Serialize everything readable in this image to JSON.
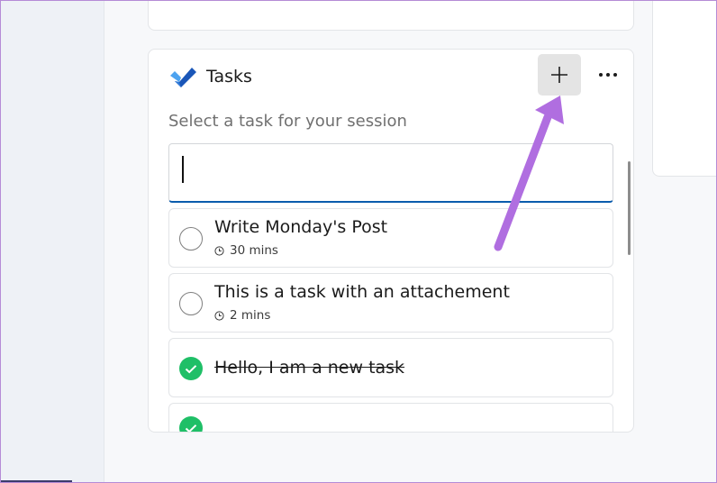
{
  "header": {
    "title": "Tasks",
    "add_icon": "plus-icon",
    "more_icon": "ellipsis-icon"
  },
  "subtitle": "Select a task for your session",
  "task_input": {
    "value": "",
    "placeholder": ""
  },
  "tasks": [
    {
      "title": "Write Monday's Post",
      "duration": "30 mins",
      "completed": false
    },
    {
      "title": "This is a task with an attachement",
      "duration": "2 mins",
      "completed": false
    },
    {
      "title": "Hello, I am a new task",
      "completed": true
    },
    {
      "completed": true
    }
  ],
  "annotation": {
    "arrow_color": "#b06ee0"
  },
  "colors": {
    "accent_blue": "#0b5cad",
    "done_green": "#1fbf67",
    "add_button_bg": "#e4e4e4",
    "todo_dark": "#1a56b8",
    "todo_light": "#4da3f0"
  }
}
